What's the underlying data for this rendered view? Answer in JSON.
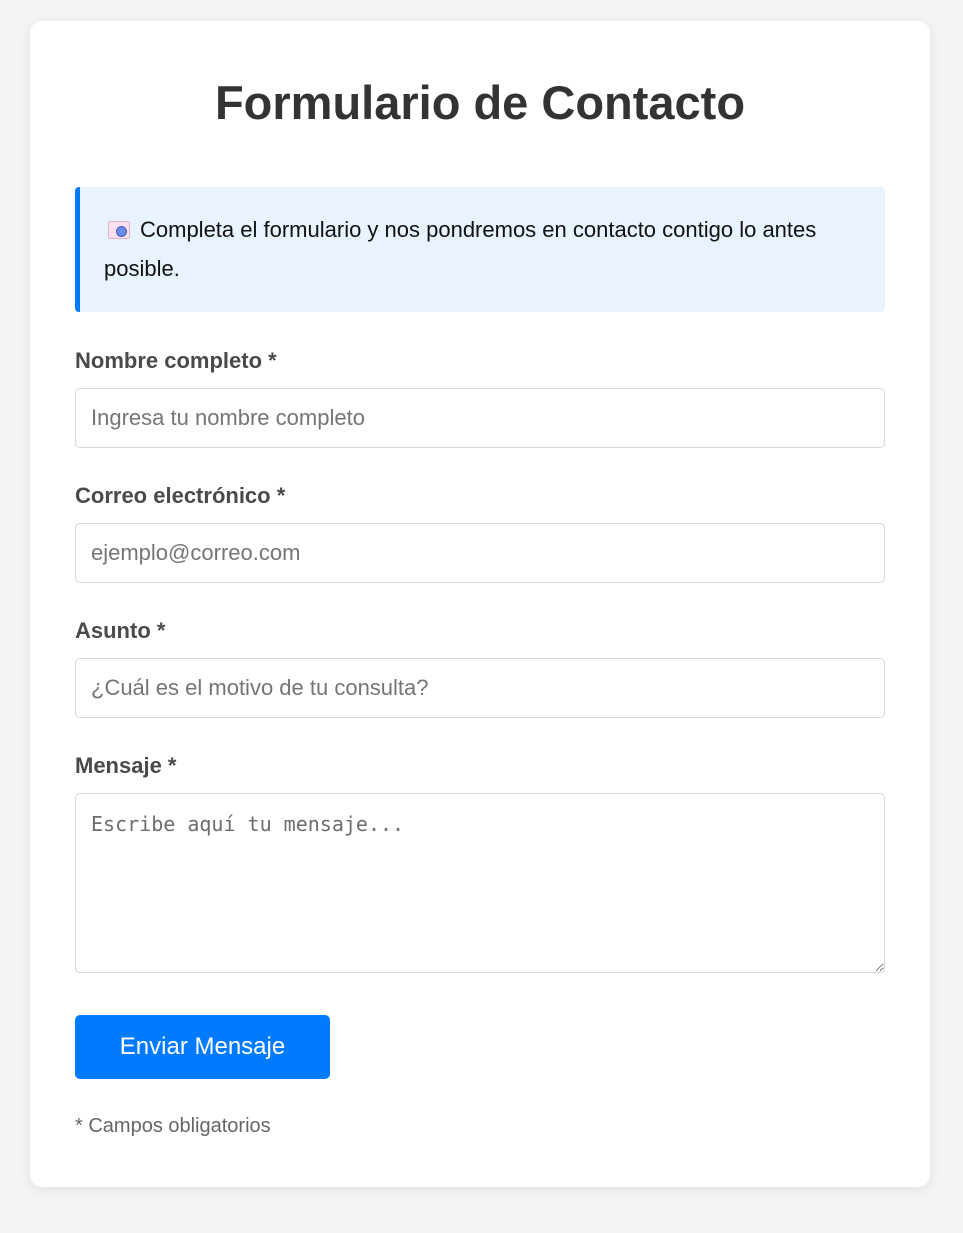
{
  "form": {
    "title": "Formulario de Contacto",
    "info_icon": "id-card-icon",
    "info_text": "Completa el formulario y nos pondremos en contacto contigo lo antes posible.",
    "fields": {
      "name": {
        "label": "Nombre completo *",
        "placeholder": "Ingresa tu nombre completo",
        "value": ""
      },
      "email": {
        "label": "Correo electrónico *",
        "placeholder": "ejemplo@correo.com",
        "value": ""
      },
      "subject": {
        "label": "Asunto *",
        "placeholder": "¿Cuál es el motivo de tu consulta?",
        "value": ""
      },
      "message": {
        "label": "Mensaje *",
        "placeholder": "Escribe aquí tu mensaje...",
        "value": ""
      }
    },
    "submit_label": "Enviar Mensaje",
    "required_note": "* Campos obligatorios"
  },
  "colors": {
    "background": "#f4f4f4",
    "card": "#ffffff",
    "accent": "#007bff",
    "info_background": "#e7f3ff",
    "title": "#333333",
    "label": "#4a4a4a"
  }
}
